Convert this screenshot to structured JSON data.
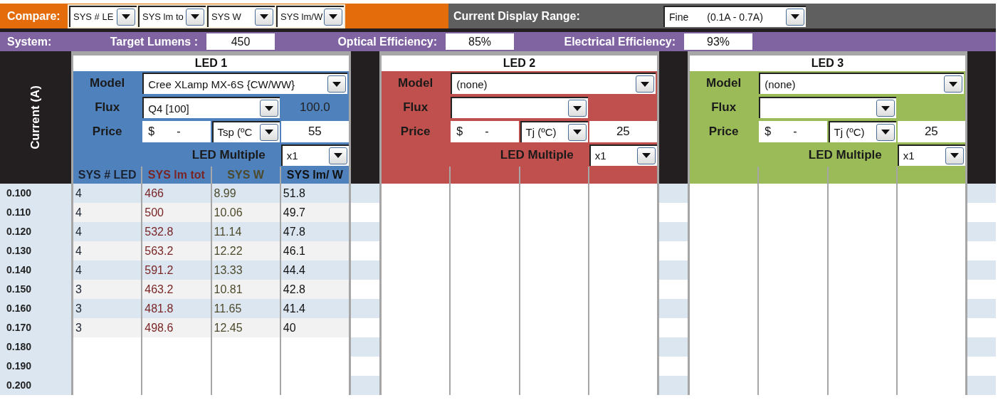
{
  "compare": {
    "label": "Compare:",
    "options": [
      "SYS # LE",
      "SYS lm to",
      "SYS W",
      "SYS lm/W"
    ]
  },
  "display_range": {
    "label": "Current Display Range:",
    "value": "Fine",
    "range": "(0.1A - 0.7A)"
  },
  "system": {
    "label": "System:",
    "fields": [
      {
        "label": "Target Lumens :",
        "value": "450"
      },
      {
        "label": "Optical Efficiency:",
        "value": "85%"
      },
      {
        "label": "Electrical Efficiency:",
        "value": "93%"
      }
    ]
  },
  "axis_label": "Current (A)",
  "currents": [
    "0.100",
    "0.110",
    "0.120",
    "0.130",
    "0.140",
    "0.150",
    "0.160",
    "0.170",
    "0.180",
    "0.190",
    "0.200"
  ],
  "leds": [
    {
      "title": "LED 1",
      "color": "#4f81bd",
      "model_label": "Model",
      "model": "Cree XLamp MX-6S {CW/WW}",
      "flux_label": "Flux",
      "flux": "Q4 [100]",
      "flux_value": "100.0",
      "price_label": "Price",
      "currency": "$",
      "price": "-",
      "temp_option": "Tsp (ºC",
      "temp": "55",
      "multiple_label": "LED Multiple",
      "multiple": "x1",
      "columns": [
        "SYS # LED",
        "SYS lm tot",
        "SYS W",
        "SYS lm/ W"
      ],
      "rows": [
        [
          "4",
          "466",
          "8.99",
          "51.8"
        ],
        [
          "4",
          "500",
          "10.06",
          "49.7"
        ],
        [
          "4",
          "532.8",
          "11.14",
          "47.8"
        ],
        [
          "4",
          "563.2",
          "12.22",
          "46.1"
        ],
        [
          "4",
          "591.2",
          "13.33",
          "44.4"
        ],
        [
          "3",
          "463.2",
          "10.81",
          "42.8"
        ],
        [
          "3",
          "481.8",
          "11.65",
          "41.4"
        ],
        [
          "3",
          "498.6",
          "12.45",
          "40"
        ]
      ]
    },
    {
      "title": "LED 2",
      "color": "#c0504d",
      "model_label": "Model",
      "model": "(none)",
      "flux_label": "Flux",
      "price_label": "Price",
      "currency": "$",
      "price": "-",
      "temp_option": "Tj (ºC)",
      "temp": "25",
      "multiple_label": "LED Multiple",
      "multiple": "x1"
    },
    {
      "title": "LED 3",
      "color": "#9bbb59",
      "model_label": "Model",
      "model": "(none)",
      "flux_label": "Flux",
      "price_label": "Price",
      "currency": "$",
      "price": "-",
      "temp_option": "Tj (ºC)",
      "temp": "25",
      "multiple_label": "LED Multiple",
      "multiple": "x1"
    }
  ]
}
